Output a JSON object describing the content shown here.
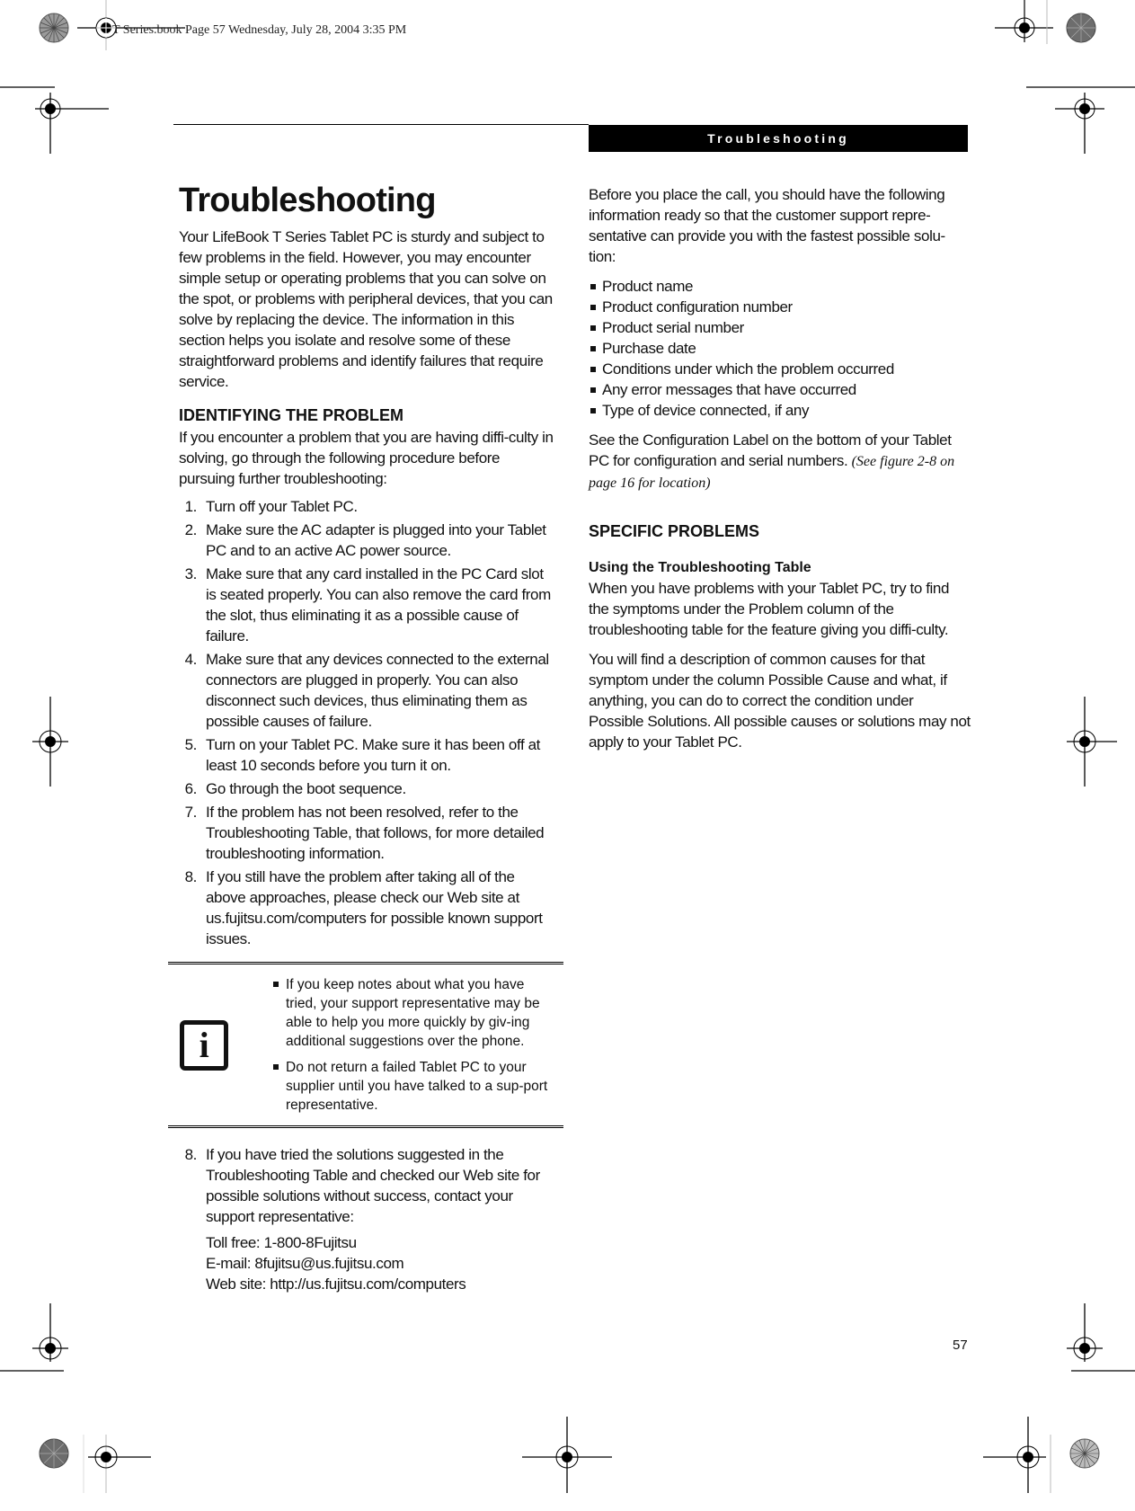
{
  "slug_line": "T Series.book  Page 57  Wednesday, July 28, 2004  3:35 PM",
  "running_header": "Troubleshooting",
  "page_number": "57",
  "left": {
    "title": "Troubleshooting",
    "intro": "Your LifeBook T Series Tablet PC is sturdy and subject to few problems in the field. However, you may encounter simple setup or operating problems that you can solve on the spot, or problems with peripheral devices, that you can solve by replacing the device. The information in this section helps you isolate and resolve some of these straightforward problems and identify failures that require service.",
    "section_heading": "IDENTIFYING THE PROBLEM",
    "section_intro": "If you encounter a problem that you are having diffi-culty in solving, go through the following procedure before pursuing further troubleshooting:",
    "steps": [
      {
        "num": "1.",
        "text": "Turn off your Tablet PC."
      },
      {
        "num": "2.",
        "text": "Make sure the AC adapter is plugged into your Tablet PC and to an active AC power source."
      },
      {
        "num": "3.",
        "text": "Make sure that any card installed in the PC Card slot is seated properly. You can also remove the card from the slot, thus eliminating it as a possible cause of failure."
      },
      {
        "num": "4.",
        "text": "Make sure that any devices connected to the external connectors are plugged in properly. You can also disconnect such devices, thus eliminating them as possible causes of failure."
      },
      {
        "num": "5.",
        "text": "Turn on your Tablet PC. Make sure it has been off at least 10 seconds before you turn it on."
      },
      {
        "num": "6.",
        "text": "Go through the boot sequence."
      },
      {
        "num": "7.",
        "text": "If the problem has not been resolved, refer to the Troubleshooting Table, that follows, for more detailed troubleshooting information."
      },
      {
        "num": "8.",
        "text": "If you still have the problem after taking all of the above approaches, please check our Web site at us.fujitsu.com/computers for possible known support issues."
      }
    ],
    "note": {
      "icon": "i",
      "items": [
        "If you keep notes about what you have tried, your support representative may be able to help you more quickly by giv-ing additional suggestions over the phone.",
        "Do not return a failed Tablet PC to your supplier until you have talked to a sup-port representative."
      ]
    },
    "final_step": {
      "num": "8.",
      "text": "If you have tried the solutions suggested in the Troubleshooting Table and checked our Web site for possible solutions without success, contact your support representative:"
    },
    "contact": {
      "toll_free": "Toll free: 1-800-8Fujitsu",
      "email": "E-mail: 8fujitsu@us.fujitsu.com",
      "website": "Web site: http://us.fujitsu.com/computers"
    }
  },
  "right": {
    "intro": "Before you place the call, you should have the following information ready so that the customer support repre-sentative can provide you with the fastest possible solu-tion:",
    "checklist": [
      "Product name",
      "Product configuration number",
      "Product serial number",
      "Purchase date",
      "Conditions under which the problem occurred",
      "Any error messages that have occurred",
      "Type of device connected, if any"
    ],
    "config_note": "See the Configuration Label on the bottom of your Tablet PC for configuration and serial numbers.",
    "config_ref": "(See figure 2-8 on page 16 for location)",
    "section_heading": "SPECIFIC PROBLEMS",
    "subheading": "Using the Troubleshooting Table",
    "para1": "When you have problems with your Tablet PC, try to find the symptoms under the Problem column of the troubleshooting table for the feature giving you diffi-culty.",
    "para2": "You will find a description of common causes for that symptom under the column Possible Cause and what, if anything, you can do to correct the condition under Possible Solutions. All possible causes or solutions may not apply to your Tablet PC."
  }
}
